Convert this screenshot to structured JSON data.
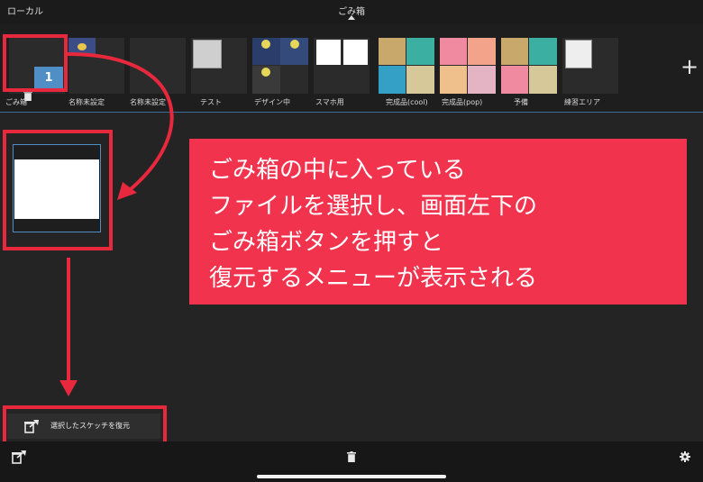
{
  "header": {
    "left_label": "ローカル",
    "title": "ごみ箱"
  },
  "albums": [
    {
      "label": "ごみ箱"
    },
    {
      "label": "名称未設定"
    },
    {
      "label": "名称未設定"
    },
    {
      "label": "テスト"
    },
    {
      "label": "デザイン中"
    },
    {
      "label": "スマホ用"
    },
    {
      "label": "完成品(cool)"
    },
    {
      "label": "完成品(pop)"
    },
    {
      "label": "予備"
    },
    {
      "label": "練習エリア"
    }
  ],
  "selection_count": "1",
  "callout": {
    "lines": [
      "ごみ箱の中に入っている",
      "ファイルを選択し、画面左下の",
      "ごみ箱ボタンを押すと",
      "復元するメニューが表示される"
    ]
  },
  "restore_menu": {
    "label": "選択したスケッチを復元"
  },
  "icons": {
    "add": "plus-icon",
    "trash": "trash-icon",
    "restore": "restore-icon",
    "settings": "gear-icon"
  },
  "colors": {
    "accent": "#4f8fc6",
    "annotation": "#e8283c",
    "callout": "#f2334e"
  }
}
